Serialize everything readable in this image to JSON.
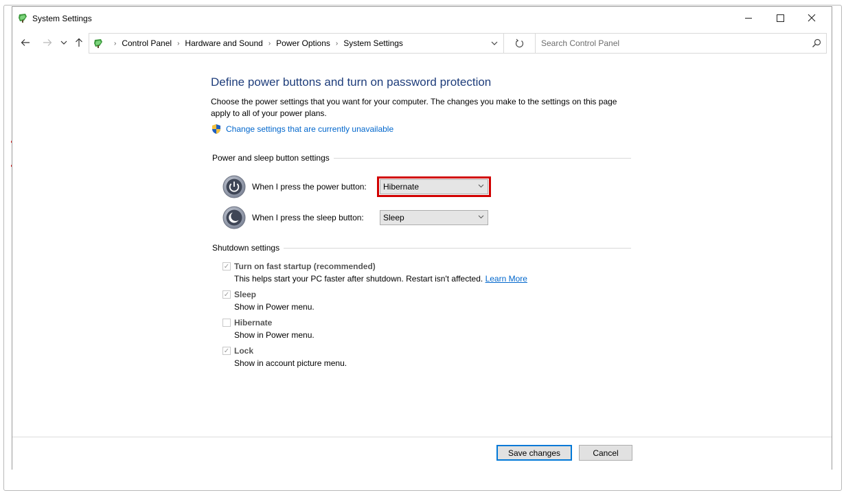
{
  "window": {
    "title": "System Settings",
    "minimize_label": "—",
    "maximize_label": "□",
    "close_label": "✕"
  },
  "address_bar": {
    "breadcrumbs": [
      "Control Panel",
      "Hardware and Sound",
      "Power Options",
      "System Settings"
    ],
    "separator": "›"
  },
  "search": {
    "placeholder": "Search Control Panel"
  },
  "page": {
    "heading": "Define power buttons and turn on password protection",
    "description": "Choose the power settings that you want for your computer. The changes you make to the settings on this page apply to all of your power plans.",
    "uac_link": "Change settings that are currently unavailable"
  },
  "power_sleep": {
    "group_label": "Power and sleep button settings",
    "power_button": {
      "label": "When I press the power button:",
      "value": "Hibernate"
    },
    "sleep_button": {
      "label": "When I press the sleep button:",
      "value": "Sleep"
    }
  },
  "shutdown": {
    "group_label": "Shutdown settings",
    "items": [
      {
        "title": "Turn on fast startup (recommended)",
        "checked": true,
        "desc": "This helps start your PC faster after shutdown. Restart isn't affected.",
        "link": "Learn More"
      },
      {
        "title": "Sleep",
        "checked": true,
        "desc": "Show in Power menu."
      },
      {
        "title": "Hibernate",
        "checked": false,
        "desc": "Show in Power menu."
      },
      {
        "title": "Lock",
        "checked": true,
        "desc": "Show in account picture menu."
      }
    ]
  },
  "footer": {
    "save_label": "Save changes",
    "cancel_label": "Cancel"
  },
  "colors": {
    "heading": "#1e3d7b",
    "link": "#0066cc",
    "highlight": "#d10000",
    "default_button_border": "#0078d7"
  },
  "icons": [
    "control-panel-icon",
    "back-arrow-icon",
    "forward-arrow-icon",
    "chevron-down-icon",
    "up-arrow-icon",
    "refresh-icon",
    "search-icon",
    "uac-shield-icon",
    "power-icon",
    "sleep-icon",
    "checkmark-icon"
  ]
}
